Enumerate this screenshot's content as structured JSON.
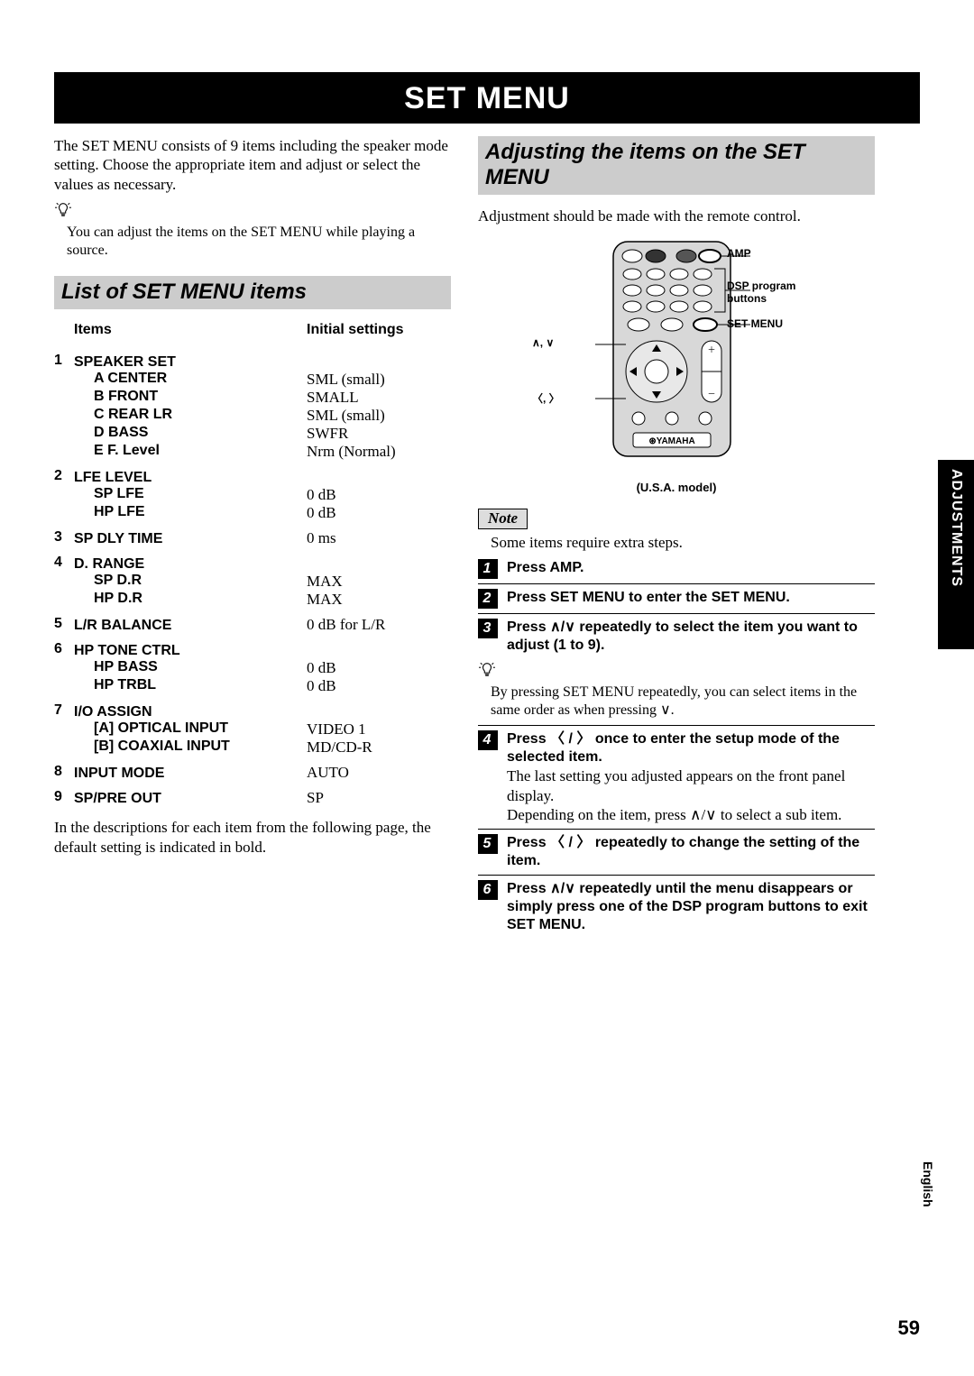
{
  "title": "SET MENU",
  "intro": "The SET MENU consists of 9 items including the speaker mode setting. Choose the appropriate item and adjust or select the values as necessary.",
  "tip1": "You can adjust the items on the SET MENU while playing a source.",
  "left_heading": "List of SET MENU items",
  "table": {
    "header_items": "Items",
    "header_init": "Initial settings",
    "rows": [
      {
        "n": "1",
        "name": "SPEAKER SET",
        "subs": [
          {
            "name": "A CENTER",
            "val": "SML (small)"
          },
          {
            "name": "B FRONT",
            "val": "SMALL"
          },
          {
            "name": "C REAR LR",
            "val": "SML (small)"
          },
          {
            "name": "D BASS",
            "val": "SWFR"
          },
          {
            "name": "E F. Level",
            "val": "Nrm (Normal)"
          }
        ]
      },
      {
        "n": "2",
        "name": "LFE LEVEL",
        "subs": [
          {
            "name": "SP LFE",
            "val": "0 dB"
          },
          {
            "name": "HP LFE",
            "val": "0 dB"
          }
        ]
      },
      {
        "n": "3",
        "name": "SP DLY TIME",
        "val": "0 ms"
      },
      {
        "n": "4",
        "name": "D. RANGE",
        "subs": [
          {
            "name": "SP D.R",
            "val": "MAX"
          },
          {
            "name": "HP D.R",
            "val": "MAX"
          }
        ]
      },
      {
        "n": "5",
        "name": "L/R BALANCE",
        "val": "0 dB for L/R"
      },
      {
        "n": "6",
        "name": "HP TONE CTRL",
        "subs": [
          {
            "name": "HP BASS",
            "val": "0 dB"
          },
          {
            "name": "HP TRBL",
            "val": "0 dB"
          }
        ]
      },
      {
        "n": "7",
        "name": "I/O ASSIGN",
        "subs": [
          {
            "name": "[A] OPTICAL INPUT",
            "val": "VIDEO 1"
          },
          {
            "name": "[B] COAXIAL INPUT",
            "val": "MD/CD-R"
          }
        ]
      },
      {
        "n": "8",
        "name": "INPUT MODE",
        "val": "AUTO"
      },
      {
        "n": "9",
        "name": "SP/PRE OUT",
        "val": "SP"
      }
    ]
  },
  "after_table": "In the descriptions for each item from the following page, the default setting is indicated in bold.",
  "right_heading": "Adjusting the items on the SET MENU",
  "right_intro": "Adjustment should be made with the remote control.",
  "remote": {
    "labels": {
      "amp": "AMP",
      "dsp": "DSP program buttons",
      "setmenu": "SET MENU",
      "ud": "∧, ∨",
      "lr": "〈, 〉"
    },
    "caption": "(U.S.A. model)"
  },
  "note_label": "Note",
  "note_text": "Some items require extra steps.",
  "steps": [
    {
      "n": "1",
      "bold": "Press AMP."
    },
    {
      "n": "2",
      "bold": "Press SET MENU to enter the SET MENU."
    },
    {
      "n": "3",
      "bold": "Press ∧/∨ repeatedly to select the item you want to adjust (1 to 9)."
    },
    {
      "tip": "By pressing SET MENU repeatedly, you can select items in the same order as when pressing ∨."
    },
    {
      "n": "4",
      "bold": "Press 〈 / 〉 once to enter the setup mode of the selected item.",
      "plain": [
        "The last setting you adjusted appears on the front panel display.",
        "Depending on the item, press ∧/∨ to select a sub item."
      ]
    },
    {
      "n": "5",
      "bold": "Press 〈 / 〉 repeatedly to change the setting of the item."
    },
    {
      "n": "6",
      "bold": "Press ∧/∨ repeatedly until the menu disappears or simply press one of the DSP program buttons to exit SET MENU."
    }
  ],
  "side_tab": "ADJUSTMENTS",
  "side_lang": "English",
  "page_num": "59",
  "chart_data": {
    "type": "table",
    "title": "List of SET MENU items — Initial settings",
    "columns": [
      "Item #",
      "Item",
      "Sub-item",
      "Initial setting"
    ],
    "rows": [
      [
        1,
        "SPEAKER SET",
        "A CENTER",
        "SML (small)"
      ],
      [
        1,
        "SPEAKER SET",
        "B FRONT",
        "SMALL"
      ],
      [
        1,
        "SPEAKER SET",
        "C REAR LR",
        "SML (small)"
      ],
      [
        1,
        "SPEAKER SET",
        "D BASS",
        "SWFR"
      ],
      [
        1,
        "SPEAKER SET",
        "E F. Level",
        "Nrm (Normal)"
      ],
      [
        2,
        "LFE LEVEL",
        "SP LFE",
        "0 dB"
      ],
      [
        2,
        "LFE LEVEL",
        "HP LFE",
        "0 dB"
      ],
      [
        3,
        "SP DLY TIME",
        "",
        "0 ms"
      ],
      [
        4,
        "D. RANGE",
        "SP D.R",
        "MAX"
      ],
      [
        4,
        "D. RANGE",
        "HP D.R",
        "MAX"
      ],
      [
        5,
        "L/R BALANCE",
        "",
        "0 dB for L/R"
      ],
      [
        6,
        "HP TONE CTRL",
        "HP BASS",
        "0 dB"
      ],
      [
        6,
        "HP TONE CTRL",
        "HP TRBL",
        "0 dB"
      ],
      [
        7,
        "I/O ASSIGN",
        "[A] OPTICAL INPUT",
        "VIDEO 1"
      ],
      [
        7,
        "I/O ASSIGN",
        "[B] COAXIAL INPUT",
        "MD/CD-R"
      ],
      [
        8,
        "INPUT MODE",
        "",
        "AUTO"
      ],
      [
        9,
        "SP/PRE OUT",
        "",
        "SP"
      ]
    ]
  }
}
